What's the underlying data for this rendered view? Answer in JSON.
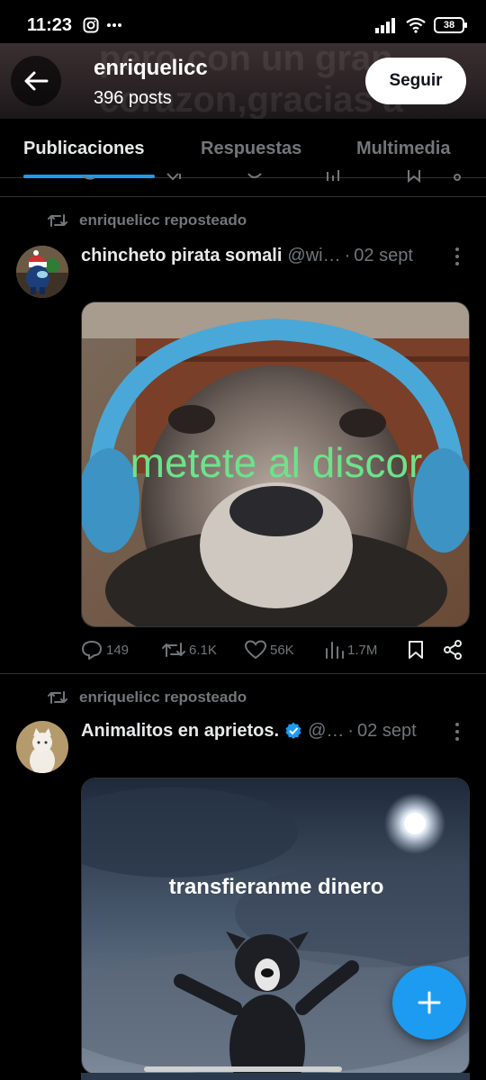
{
  "status_bar": {
    "time": "11:23",
    "battery": "38"
  },
  "header": {
    "bg_text_line1": "pero con un gran",
    "bg_text_line2": "corazon,gracias a",
    "profile_name": "enriquelicc",
    "posts_count": "396 posts",
    "follow_label": "Seguir"
  },
  "tabs": [
    {
      "label": "Publicaciones",
      "active": true
    },
    {
      "label": "Respuestas",
      "active": false
    },
    {
      "label": "Multimedia",
      "active": false
    }
  ],
  "tweets": [
    {
      "repost_label": "enriquelicc reposteado",
      "name": "chincheto pirata somali",
      "handle": "@wi…",
      "date": "02 sept",
      "media_caption": "metete al discor",
      "stats": {
        "replies": "149",
        "reposts": "6.1K",
        "likes": "56K",
        "views": "1.7M"
      }
    },
    {
      "repost_label": "enriquelicc reposteado",
      "name": "Animalitos en aprietos.",
      "handle": "@…",
      "date": "02 sept",
      "verified": true,
      "media_caption": "transfieranme dinero"
    }
  ],
  "colors": {
    "accent": "#1d9bf0",
    "caption_green": "#6ee28a",
    "muted": "#71767b"
  },
  "icons": {
    "back": "arrow-left-icon",
    "repost": "repost-icon",
    "reply": "reply-icon",
    "like": "heart-icon",
    "views": "views-icon",
    "bookmark": "bookmark-icon",
    "share": "share-icon",
    "compose": "plus-icon"
  }
}
